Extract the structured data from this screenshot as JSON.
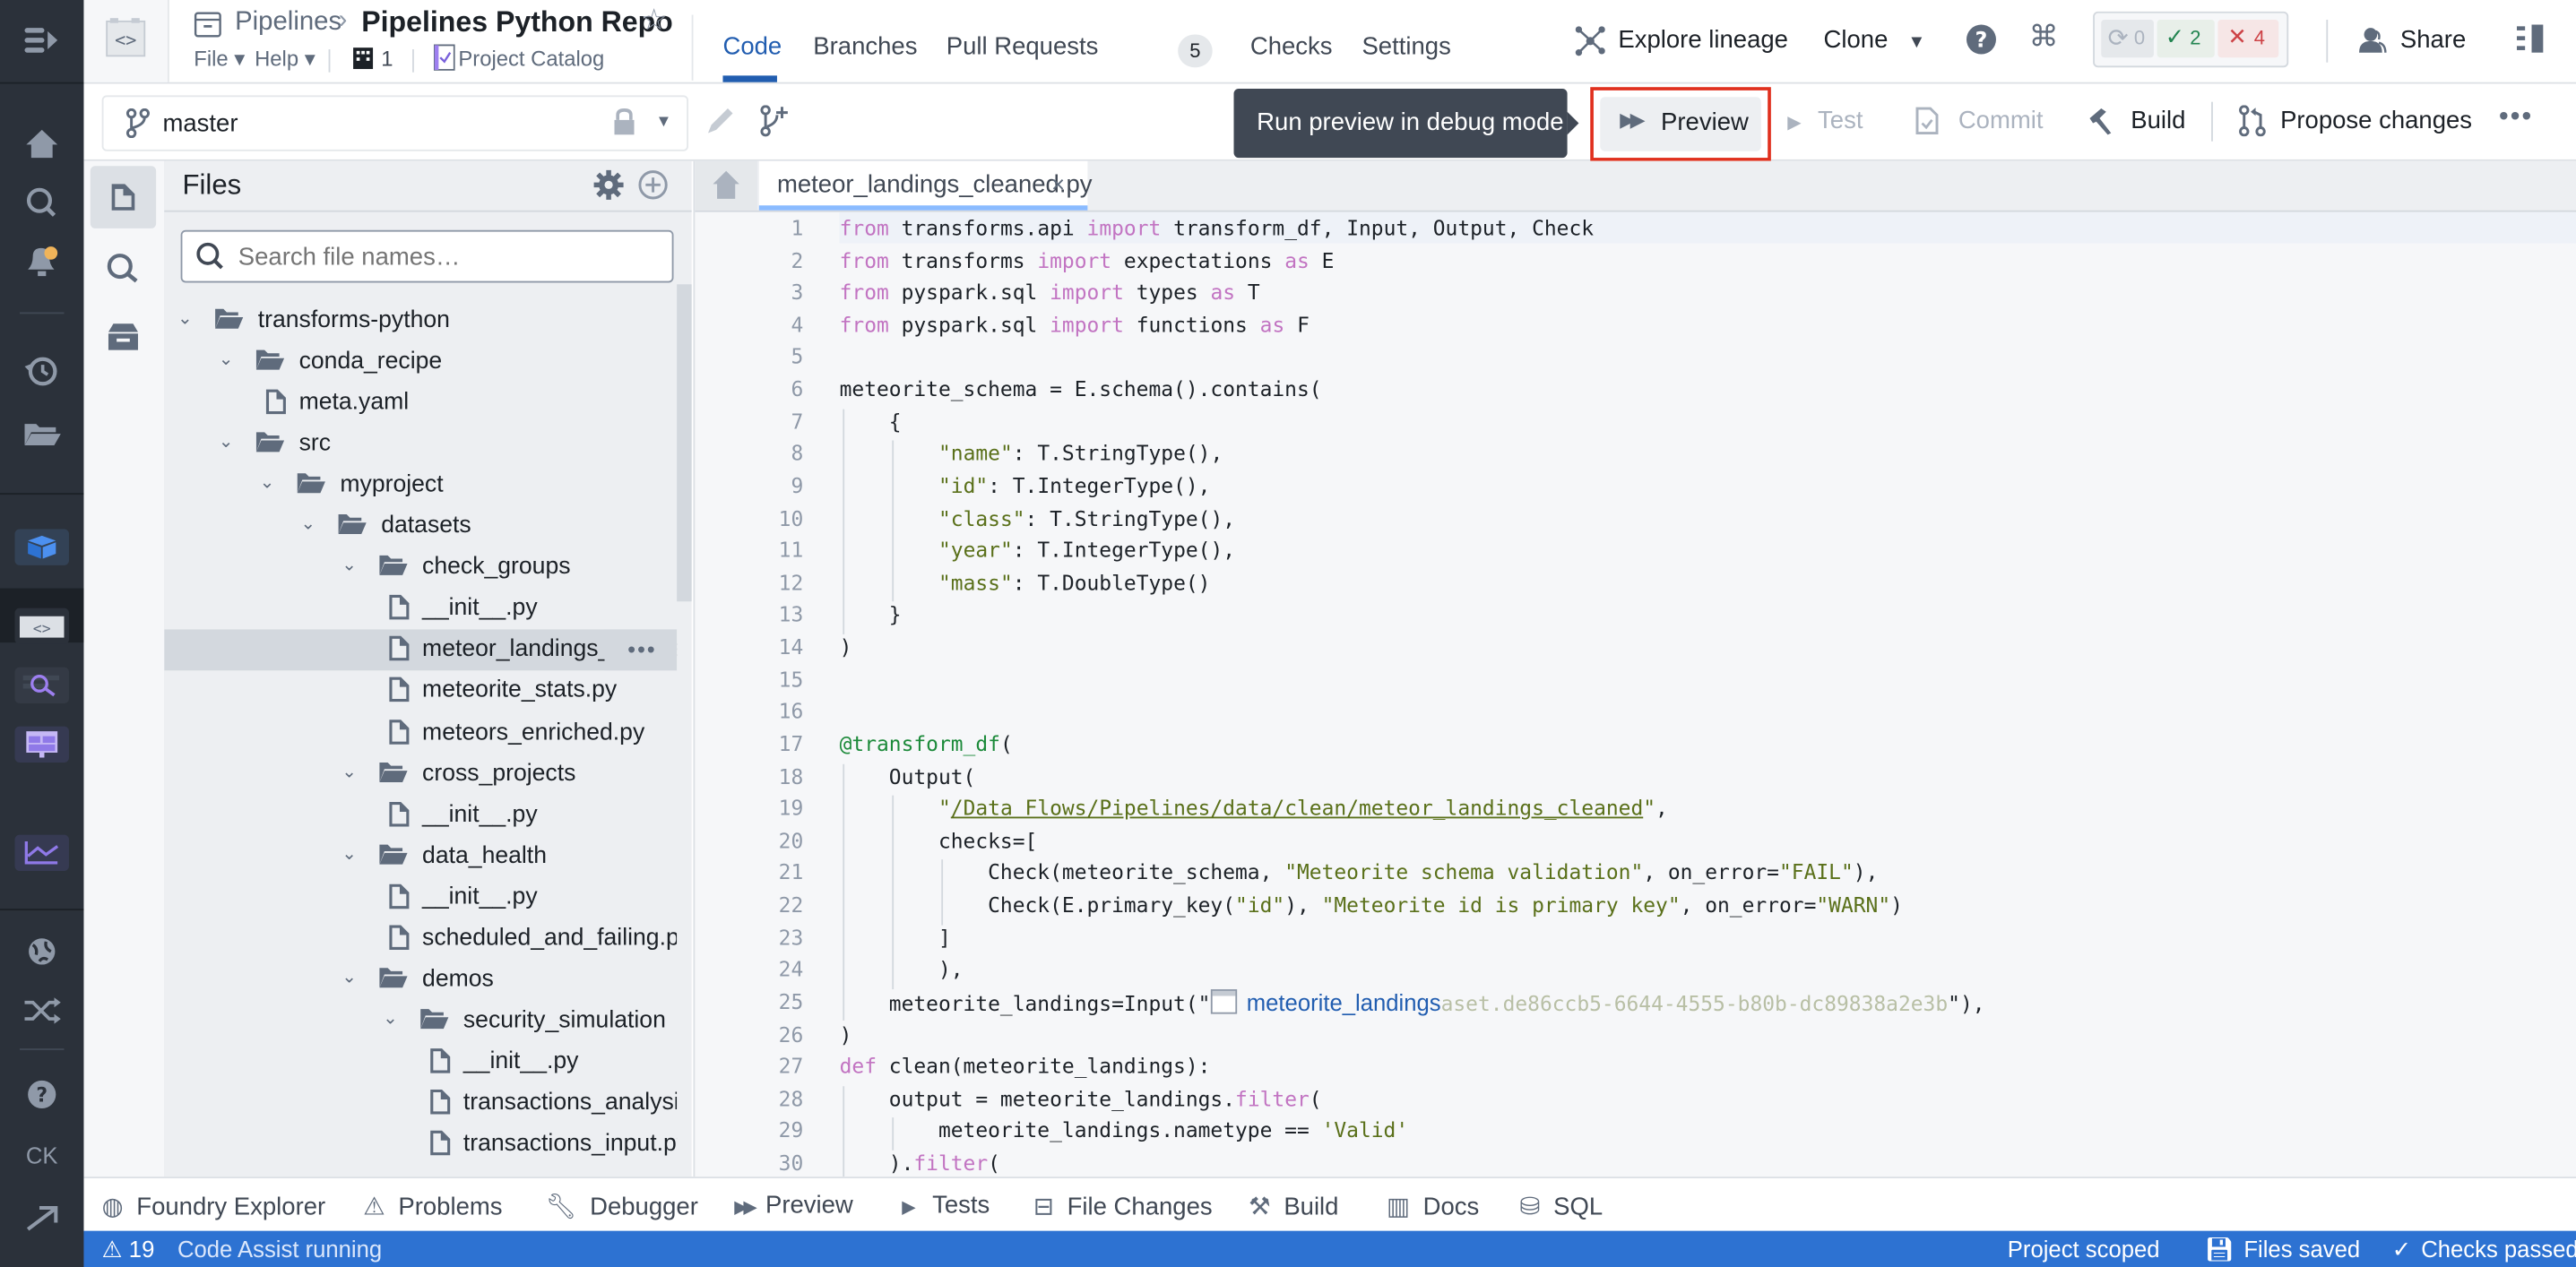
{
  "header": {
    "breadcrumb_parent": "Pipelines",
    "repo_title": "Pipelines Python Repo",
    "menus": [
      "File",
      "Help"
    ],
    "org_count": "1",
    "project_catalog": "Project Catalog",
    "tabs": [
      {
        "label": "Code",
        "active": true
      },
      {
        "label": "Branches"
      },
      {
        "label": "Pull Requests",
        "badge": "5"
      },
      {
        "label": "Checks"
      },
      {
        "label": "Settings"
      }
    ],
    "explore_lineage": "Explore lineage",
    "clone": "Clone",
    "checks_summary": {
      "running": "0",
      "passed": "2",
      "failed": "4"
    },
    "share": "Share"
  },
  "toolbar": {
    "branch": "master",
    "tooltip": "Run preview in debug mode",
    "preview": "Preview",
    "test": "Test",
    "commit": "Commit",
    "build": "Build",
    "propose_changes": "Propose changes"
  },
  "files_panel": {
    "title": "Files",
    "search_placeholder": "Search file names…",
    "tree": [
      {
        "label": "transforms-python",
        "type": "folder",
        "depth": 0
      },
      {
        "label": "conda_recipe",
        "type": "folder",
        "depth": 1
      },
      {
        "label": "meta.yaml",
        "type": "file",
        "depth": 2
      },
      {
        "label": "src",
        "type": "folder",
        "depth": 1
      },
      {
        "label": "myproject",
        "type": "folder",
        "depth": 2
      },
      {
        "label": "datasets",
        "type": "folder",
        "depth": 3
      },
      {
        "label": "check_groups",
        "type": "folder",
        "depth": 4
      },
      {
        "label": "__init__.py",
        "type": "file",
        "depth": 5
      },
      {
        "label": "meteor_landings_cleaned.py",
        "type": "file",
        "depth": 5,
        "selected": true
      },
      {
        "label": "meteorite_stats.py",
        "type": "file",
        "depth": 5
      },
      {
        "label": "meteors_enriched.py",
        "type": "file",
        "depth": 5
      },
      {
        "label": "cross_projects",
        "type": "folder",
        "depth": 4
      },
      {
        "label": "__init__.py",
        "type": "file",
        "depth": 5
      },
      {
        "label": "data_health",
        "type": "folder",
        "depth": 4
      },
      {
        "label": "__init__.py",
        "type": "file",
        "depth": 5
      },
      {
        "label": "scheduled_and_failing.py",
        "type": "file",
        "depth": 5
      },
      {
        "label": "demos",
        "type": "folder",
        "depth": 4
      },
      {
        "label": "security_simulation",
        "type": "folder",
        "depth": 5
      },
      {
        "label": "__init__.py",
        "type": "file",
        "depth": 6
      },
      {
        "label": "transactions_analysis.py",
        "type": "file",
        "depth": 6
      },
      {
        "label": "transactions_input.py",
        "type": "file",
        "depth": 6
      }
    ]
  },
  "editor": {
    "open_tab": "meteor_landings_cleaned.py",
    "lines": [
      "from transforms.api import transform_df, Input, Output, Check",
      "from transforms import expectations as E",
      "from pyspark.sql import types as T",
      "from pyspark.sql import functions as F",
      "",
      "meteorite_schema = E.schema().contains(",
      "    {",
      "        \"name\": T.StringType(),",
      "        \"id\": T.IntegerType(),",
      "        \"class\": T.StringType(),",
      "        \"year\": T.IntegerType(),",
      "        \"mass\": T.DoubleType()",
      "    }",
      ")",
      "",
      "",
      "@transform_df(",
      "    Output(",
      "        \"/Data Flows/Pipelines/data/clean/meteor_landings_cleaned\",",
      "        checks=[",
      "            Check(meteorite_schema, \"Meteorite schema validation\", on_error=\"FAIL\"),",
      "            Check(E.primary_key(\"id\"), \"Meteorite id is primary key\", on_error=\"WARN\")",
      "        ]",
      "        ),",
      "    meteorite_landings=Input(\"meteorite_landings aset.de86ccb5-6644-4555-b80b-dc89838a2e3b\"),",
      ")",
      "def clean(meteorite_landings):",
      "    output = meteorite_landings.filter(",
      "        meteorite_landings.nametype == 'Valid'",
      "    ).filter("
    ],
    "dataset_link": "meteorite_landings",
    "dataset_rid_tail": "aset.de86ccb5-6644-4555-b80b-dc89838a2e3b"
  },
  "bottom_panel": {
    "tabs": [
      "Foundry Explorer",
      "Problems",
      "Debugger",
      "Preview",
      "Tests",
      "File Changes",
      "Build",
      "Docs",
      "SQL"
    ]
  },
  "status_bar": {
    "warnings": "19",
    "code_assist": "Code Assist running",
    "project_scoped": "Project scoped",
    "files_saved": "Files saved",
    "checks_passed": "Checks passed"
  },
  "rail": {
    "user_initials": "CK"
  }
}
